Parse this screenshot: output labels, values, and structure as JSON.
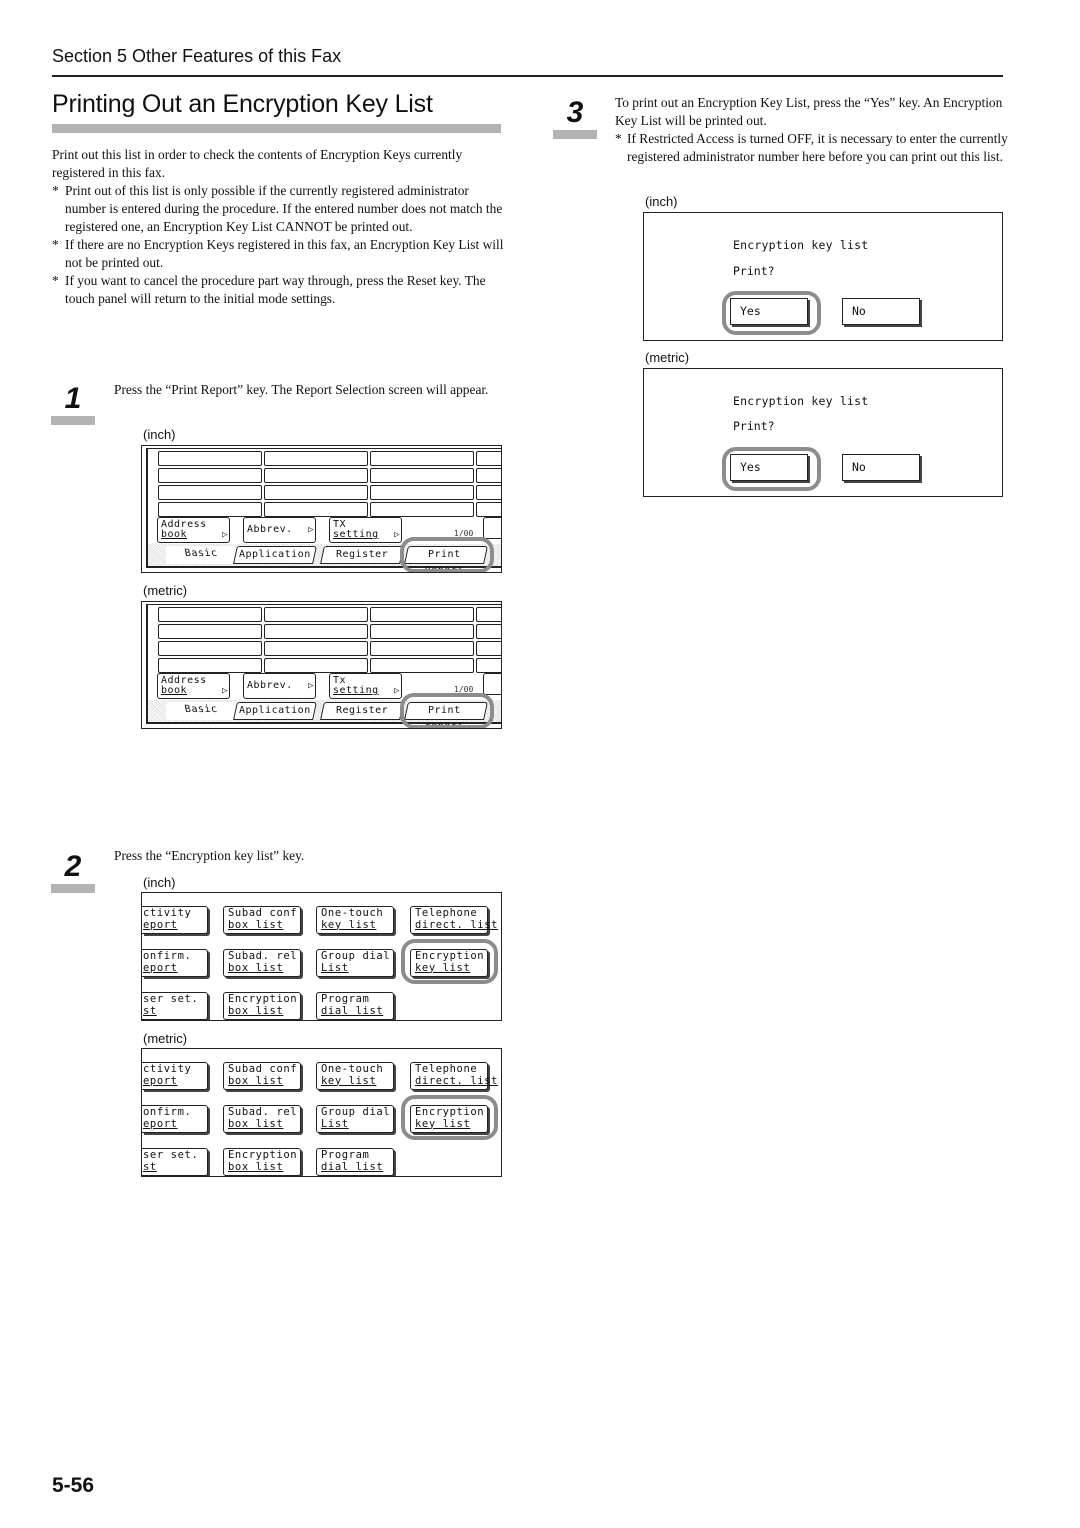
{
  "header": {
    "section": "Section 5  Other Features of this Fax",
    "title": "Printing Out an Encryption Key List"
  },
  "intro": {
    "paragraph": "Print out this list in order to check the contents of Encryption Keys currently registered in this fax.",
    "notes": [
      "Print out of this list is only possible if the currently registered administrator number is entered during the procedure. If the entered number does not match the registered one, an Encryption Key List CANNOT be printed out.",
      "If there are no Encryption Keys registered in this fax, an Encryption Key List will not be printed out.",
      "If you want to cancel the procedure part way through, press the Reset key. The touch panel will return to the initial mode settings."
    ],
    "note_marker": "*"
  },
  "steps": [
    {
      "number": "1",
      "text": "Press the “Print Report” key. The Report Selection screen will appear.",
      "screens": [
        {
          "unit": "(inch)",
          "keys": [
            {
              "line1": "Address",
              "line2": "book"
            },
            {
              "line1": "Abbrev.",
              "line2": ""
            },
            {
              "line1": "TX",
              "line2": "setting"
            }
          ],
          "page_indicator": "1/00",
          "tabs": [
            "Basic",
            "Application",
            "Register",
            "Print Report"
          ],
          "highlighted": "Print Report"
        },
        {
          "unit": "(metric)",
          "keys": [
            {
              "line1": "Address",
              "line2": "book"
            },
            {
              "line1": "Abbrev.",
              "line2": ""
            },
            {
              "line1": "Tx",
              "line2": "setting"
            }
          ],
          "page_indicator": "1/00",
          "tabs": [
            "Basic",
            "Application",
            "Register",
            "Print report"
          ],
          "highlighted": "Print report"
        }
      ]
    },
    {
      "number": "2",
      "text": "Press the “Encryption key list” key.",
      "screens": [
        {
          "unit": "(inch)",
          "keys": [
            {
              "line1": "ctivity",
              "line2": "eport"
            },
            {
              "line1": "Subad conf",
              "line2": "box list"
            },
            {
              "line1": "One-touch",
              "line2": "key list"
            },
            {
              "line1": "Telephone",
              "line2": "direct. list"
            },
            {
              "line1": "onfirm.",
              "line2": "eport"
            },
            {
              "line1": "Subad. rel",
              "line2": "box list"
            },
            {
              "line1": "Group dial",
              "line2": "List"
            },
            {
              "line1": "Encryption",
              "line2": "key list"
            },
            {
              "line1": "ser set.",
              "line2": "st"
            },
            {
              "line1": "Encryption",
              "line2": "box list"
            },
            {
              "line1": "Program",
              "line2": "dial list"
            }
          ],
          "highlighted": "Encryption key list"
        },
        {
          "unit": "(metric)",
          "keys": [
            {
              "line1": "ctivity",
              "line2": "eport"
            },
            {
              "line1": "Subad conf",
              "line2": "box list"
            },
            {
              "line1": "One-touch",
              "line2": "key list"
            },
            {
              "line1": "Telephone",
              "line2": "direct. list"
            },
            {
              "line1": "onfirm.",
              "line2": "eport"
            },
            {
              "line1": "Subad. rel",
              "line2": "box list"
            },
            {
              "line1": "Group dial",
              "line2": "List"
            },
            {
              "line1": "Encryption",
              "line2": "key list"
            },
            {
              "line1": "ser set.",
              "line2": "st"
            },
            {
              "line1": "Encryption",
              "line2": "box list"
            },
            {
              "line1": "Program",
              "line2": "dial list"
            }
          ],
          "highlighted": "Encryption key list"
        }
      ]
    },
    {
      "number": "3",
      "text": "To print out an Encryption Key List, press the “Yes” key. An Encryption Key List will be printed out.",
      "note": "If Restricted Access is turned OFF, it is necessary to enter the currently registered administrator number here before you can print out this list.",
      "screens": [
        {
          "unit": "(inch)",
          "message": "Encryption key list",
          "prompt": "Print?",
          "yes": "Yes",
          "no": "No",
          "highlighted": "Yes"
        },
        {
          "unit": "(metric)",
          "message": "Encryption  key list",
          "prompt": "Print?",
          "yes": "Yes",
          "no": "No",
          "highlighted": "Yes"
        }
      ]
    }
  ],
  "footer": {
    "page_number": "5-56"
  },
  "colors": {
    "accent_bar": "#b3b3b3",
    "highlight_ring": "#8c8c8c",
    "text": "#111111"
  }
}
